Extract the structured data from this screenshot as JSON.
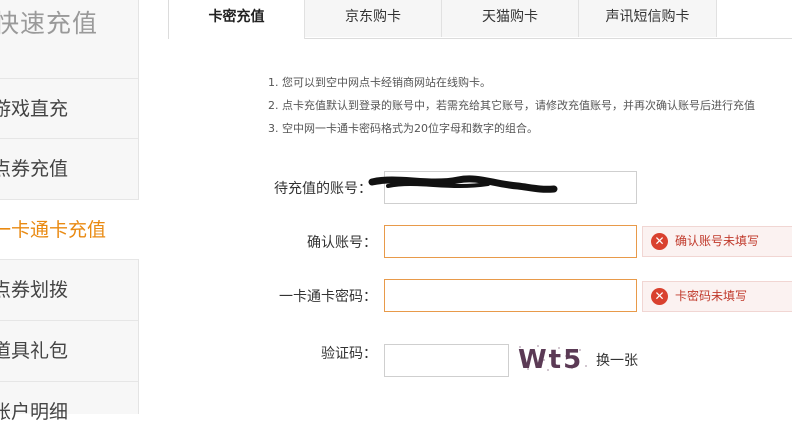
{
  "sidebar": {
    "title": "快速充值",
    "items": [
      {
        "label": "游戏直充",
        "active": false
      },
      {
        "label": "点券充值",
        "active": false
      },
      {
        "label": "一卡通卡充值",
        "active": true
      },
      {
        "label": "点券划拨",
        "active": false
      },
      {
        "label": "道具礼包",
        "active": false
      },
      {
        "label": "账户明细",
        "active": false
      }
    ]
  },
  "tabs": [
    {
      "label": "卡密充值",
      "active": true
    },
    {
      "label": "京东购卡",
      "active": false
    },
    {
      "label": "天猫购卡",
      "active": false
    },
    {
      "label": "声讯短信购卡",
      "active": false
    }
  ],
  "notes": [
    "1. 您可以到空中网点卡经销商网站在线购卡。",
    "2. 点卡充值默认到登录的账号中，若需充给其它账号，请修改充值账号，并再次确认账号后进行充值",
    "3. 空中网一卡通卡密码格式为20位字母和数字的组合。"
  ],
  "form": {
    "account_label": "待充值的账号：",
    "account_value": "",
    "confirm_label": "确认账号：",
    "confirm_value": "",
    "confirm_error": "确认账号未填写",
    "password_label": "一卡通卡密码：",
    "password_value": "",
    "password_error": "卡密码未填写",
    "captcha_label": "验证码：",
    "captcha_value": "",
    "captcha_text": "Wt5",
    "refresh_label": "换一张"
  },
  "colors": {
    "accent": "#e98a12",
    "error": "#c0392b",
    "error_icon": "#d9412f",
    "error_bg": "#fbf2f1",
    "error_border": "#e89a4a"
  }
}
